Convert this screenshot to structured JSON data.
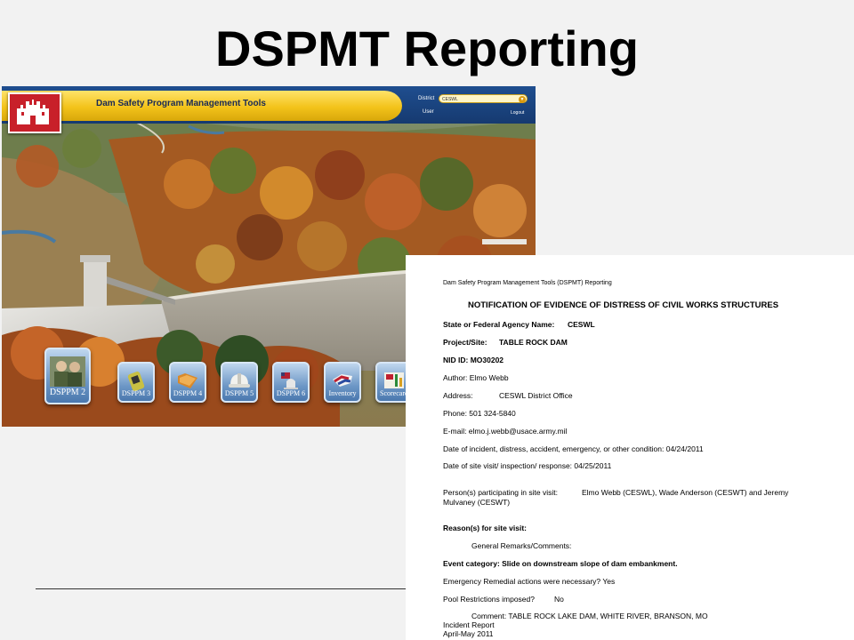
{
  "slide": {
    "title": "DSPMT Reporting"
  },
  "app": {
    "name": "Dam Safety Program Management Tools",
    "district_label": "District",
    "district_value": "CESWL",
    "user_label": "User",
    "logout_label": "Logout",
    "tiles": [
      {
        "label": "DSPPM 2"
      },
      {
        "label": "DSPPM 3"
      },
      {
        "label": "DSPPM 4"
      },
      {
        "label": "DSPPM 5"
      },
      {
        "label": "DSPPM 6"
      },
      {
        "label": "Inventory"
      },
      {
        "label": "Scorecard"
      }
    ],
    "colors": {
      "banner_blue": "#1f4e8f",
      "banner_yellow": "#f3c31a",
      "logo_red": "#c8202a",
      "tile_blue": "#6d97c6"
    }
  },
  "doc": {
    "header": "Dam Safety Program Management Tools (DSPMT) Reporting",
    "title": "NOTIFICATION OF EVIDENCE OF DISTRESS OF CIVIL WORKS STRUCTURES",
    "agency_label": "State or Federal Agency Name:",
    "agency_value": "CESWL",
    "project_label": "Project/Site:",
    "project_value": "TABLE ROCK DAM",
    "nid": "NID ID: MO30202",
    "author": "Author:  Elmo Webb",
    "address_label": "Address:",
    "address_value": "CESWL District Office",
    "phone": "Phone:  501 324-5840",
    "email": "E-mail:  elmo.j.webb@usace.army.mil",
    "incident_date": "Date of incident, distress, accident, emergency, or other condition:  04/24/2011",
    "visit_date": "Date of site visit/ inspection/ response:     04/25/2011",
    "persons_label": "Person(s) participating in site visit:",
    "persons_value": "Elmo Webb (CESWL), Wade Anderson (CESWT) and Jeremy",
    "persons_value2": "Mulvaney (CESWT)",
    "reasons_label": "Reason(s) for site visit:",
    "remarks": "General Remarks/Comments:",
    "event_category": "Event category: Slide on downstream slope of dam embankment.",
    "remedial": "Emergency Remedial actions were necessary?   Yes",
    "pool_label": "Pool Restrictions imposed?",
    "pool_value": "No",
    "comment": "Comment: TABLE ROCK LAKE DAM, WHITE RIVER, BRANSON, MO",
    "incident_report": "Incident Report",
    "period": "April-May 2011"
  }
}
